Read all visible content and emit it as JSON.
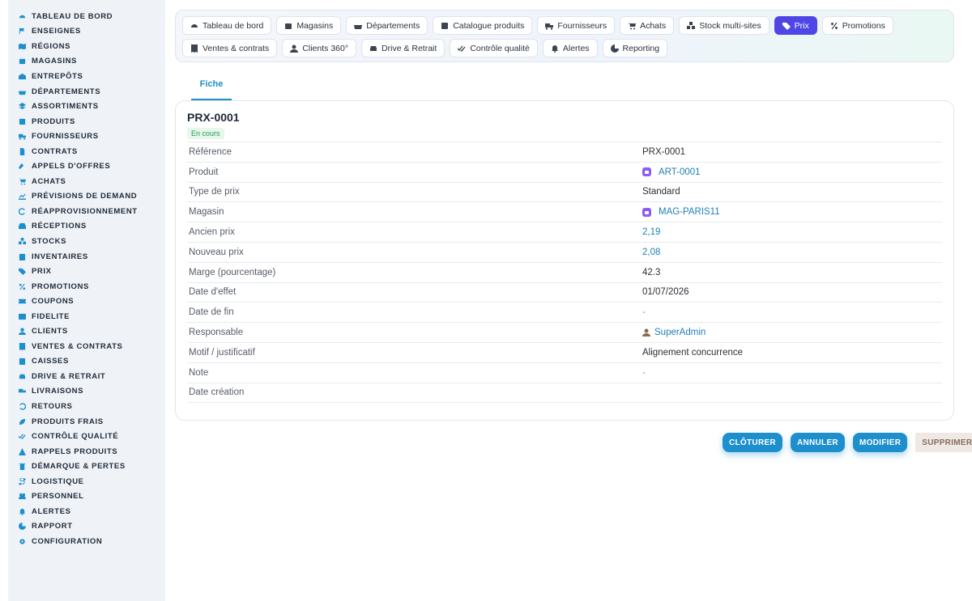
{
  "sidebar": {
    "items": [
      {
        "label": "TABLEAU DE BORD",
        "icon": "dashboard-icon"
      },
      {
        "label": "ENSEIGNES",
        "icon": "flag-icon"
      },
      {
        "label": "RÉGIONS",
        "icon": "map-icon"
      },
      {
        "label": "MAGASINS",
        "icon": "store-icon"
      },
      {
        "label": "ENTREPÔTS",
        "icon": "warehouse-icon"
      },
      {
        "label": "DÉPARTEMENTS",
        "icon": "basket-icon"
      },
      {
        "label": "ASSORTIMENTS",
        "icon": "layers-icon"
      },
      {
        "label": "PRODUITS",
        "icon": "box-icon"
      },
      {
        "label": "FOURNISSEURS",
        "icon": "truck-icon"
      },
      {
        "label": "CONTRATS",
        "icon": "document-icon"
      },
      {
        "label": "APPELS D'OFFRES",
        "icon": "gavel-icon"
      },
      {
        "label": "ACHATS",
        "icon": "cart-icon"
      },
      {
        "label": "PRÉVISIONS DE DEMAND",
        "icon": "chart-line-icon"
      },
      {
        "label": "RÉAPPROVISIONNEMENT",
        "icon": "refresh-icon"
      },
      {
        "label": "RÉCEPTIONS",
        "icon": "inbox-icon"
      },
      {
        "label": "STOCKS",
        "icon": "boxes-icon"
      },
      {
        "label": "INVENTAIRES",
        "icon": "clipboard-icon"
      },
      {
        "label": "PRIX",
        "icon": "tag-icon"
      },
      {
        "label": "PROMOTIONS",
        "icon": "percent-icon"
      },
      {
        "label": "COUPONS",
        "icon": "ticket-icon"
      },
      {
        "label": "FIDELITE",
        "icon": "card-icon"
      },
      {
        "label": "CLIENTS",
        "icon": "user-icon"
      },
      {
        "label": "VENTES & CONTRATS",
        "icon": "receipt-icon"
      },
      {
        "label": "CAISSES",
        "icon": "register-icon"
      },
      {
        "label": "DRIVE & RETRAIT",
        "icon": "car-icon"
      },
      {
        "label": "LIVRAISONS",
        "icon": "delivery-icon"
      },
      {
        "label": "RETOURS",
        "icon": "undo-icon"
      },
      {
        "label": "PRODUITS FRAIS",
        "icon": "leaf-icon"
      },
      {
        "label": "CONTRÔLE QUALITÉ",
        "icon": "check-double-icon"
      },
      {
        "label": "RAPPELS PRODUITS",
        "icon": "warning-icon"
      },
      {
        "label": "DÉMARQUE & PERTES",
        "icon": "trash-icon"
      },
      {
        "label": "LOGISTIQUE",
        "icon": "route-icon"
      },
      {
        "label": "PERSONNEL",
        "icon": "users-icon"
      },
      {
        "label": "ALERTES",
        "icon": "bell-icon"
      },
      {
        "label": "RAPPORT",
        "icon": "pie-chart-icon"
      },
      {
        "label": "CONFIGURATION",
        "icon": "gear-icon"
      }
    ]
  },
  "tabs": {
    "row1": [
      {
        "label": "Tableau de bord",
        "icon": "dashboard-icon"
      },
      {
        "label": "Magasins",
        "icon": "store-icon"
      },
      {
        "label": "Départements",
        "icon": "basket-icon"
      },
      {
        "label": "Catalogue produits",
        "icon": "box-icon"
      },
      {
        "label": "Fournisseurs",
        "icon": "truck-icon"
      },
      {
        "label": "Achats",
        "icon": "cart-icon"
      },
      {
        "label": "Stock multi-sites",
        "icon": "boxes-icon"
      },
      {
        "label": "Prix",
        "icon": "tag-icon",
        "active": true
      },
      {
        "label": "Promotions",
        "icon": "percent-icon"
      }
    ],
    "row2": [
      {
        "label": "Ventes & contrats",
        "icon": "receipt-icon"
      },
      {
        "label": "Clients 360°",
        "icon": "user-icon"
      },
      {
        "label": "Drive & Retrait",
        "icon": "car-icon"
      },
      {
        "label": "Contrôle qualité",
        "icon": "check-double-icon"
      },
      {
        "label": "Alertes",
        "icon": "bell-icon"
      },
      {
        "label": "Reporting",
        "icon": "pie-chart-icon"
      }
    ]
  },
  "subtab": {
    "label": "Fiche"
  },
  "record": {
    "title": "PRX-0001",
    "status": "En cours",
    "fields": [
      {
        "key": "Référence",
        "value": "PRX-0001",
        "kind": "text"
      },
      {
        "key": "Produit",
        "value": "ART-0001",
        "kind": "link-store"
      },
      {
        "key": "Type de prix",
        "value": "Standard",
        "kind": "text"
      },
      {
        "key": "Magasin",
        "value": "MAG-PARIS11",
        "kind": "link-store"
      },
      {
        "key": "Ancien prix",
        "value": "2,19",
        "kind": "num"
      },
      {
        "key": "Nouveau prix",
        "value": "2,08",
        "kind": "num"
      },
      {
        "key": "Marge (pourcentage)",
        "value": "42.3",
        "kind": "text"
      },
      {
        "key": "Date d'effet",
        "value": "01/07/2026",
        "kind": "text"
      },
      {
        "key": "Date de fin",
        "value": "-",
        "kind": "muted"
      },
      {
        "key": "Responsable",
        "value": "SuperAdmin",
        "kind": "link-user"
      },
      {
        "key": "Motif / justificatif",
        "value": "Alignement concurrence",
        "kind": "text"
      },
      {
        "key": "Note",
        "value": "-",
        "kind": "muted"
      },
      {
        "key": "Date création",
        "value": "",
        "kind": "text"
      }
    ]
  },
  "actions": {
    "close_label": "CLÔTURER",
    "cancel_label": "ANNULER",
    "edit_label": "MODIFIER",
    "delete_label": "SUPPRIMER"
  },
  "colors": {
    "accent": "#1d8fcc",
    "active_tab": "#4f46e5",
    "status_green": "#1f9d55"
  }
}
